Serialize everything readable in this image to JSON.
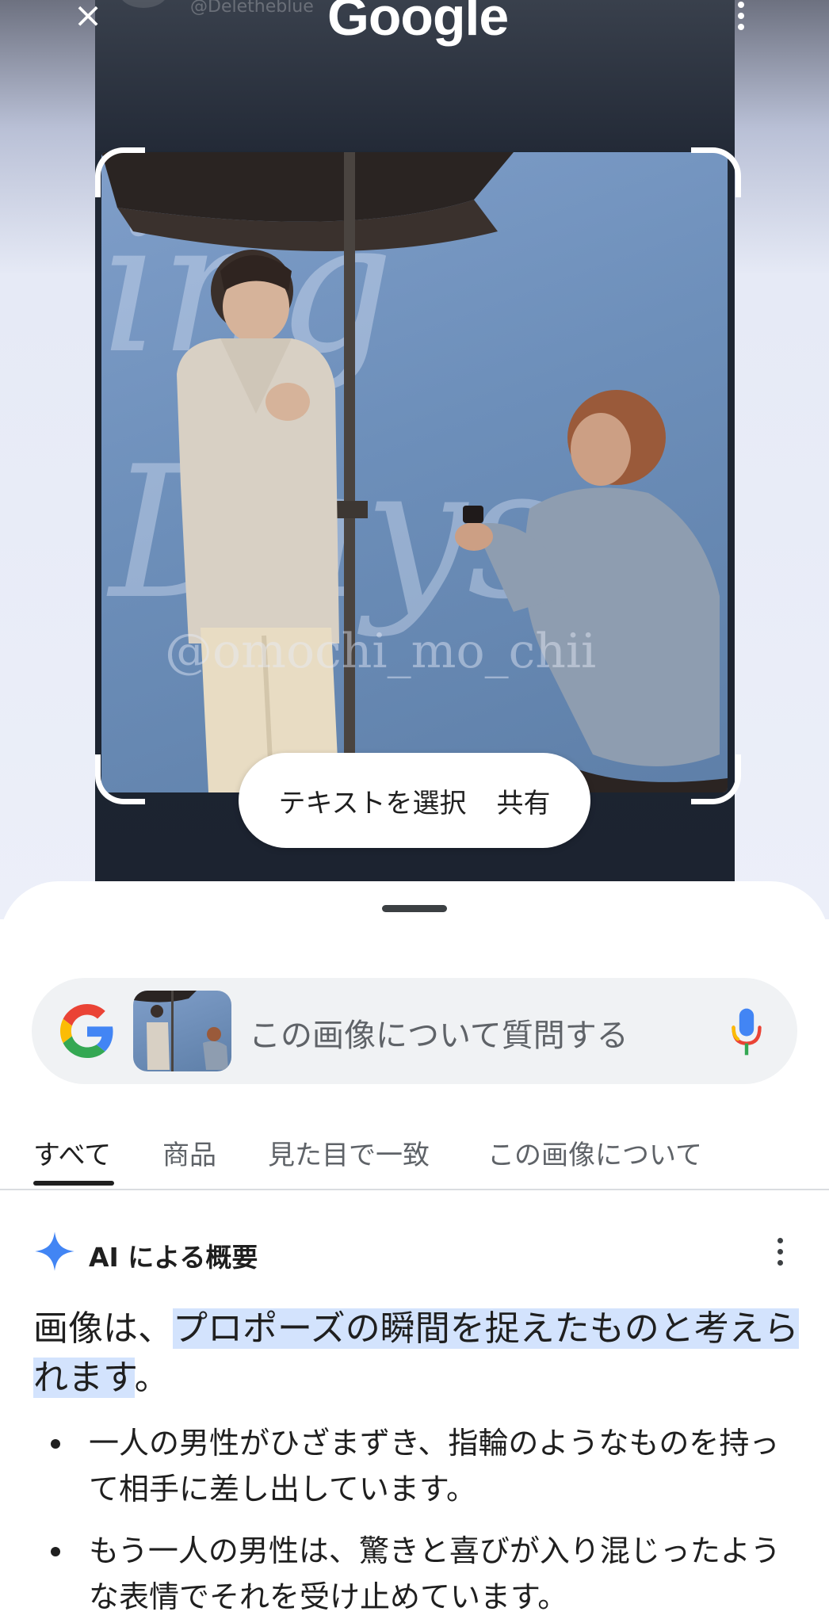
{
  "top_bar": {
    "close_label": "×",
    "logo_text": "Google",
    "menu_icon": "more-vert-icon"
  },
  "screenshot": {
    "ghost_handle": "@Deletheblue",
    "watermark": "@omochi_mo_chii"
  },
  "actions": {
    "select_text": "テキストを選択",
    "share": "共有"
  },
  "search": {
    "placeholder": "この画像について質問する",
    "left_icon": "google-g-icon",
    "right_icon": "mic-icon"
  },
  "tabs": [
    {
      "label": "すべて",
      "active": true
    },
    {
      "label": "商品",
      "active": false
    },
    {
      "label": "見た目で一致",
      "active": false
    },
    {
      "label": "この画像について",
      "active": false
    }
  ],
  "ai_overview": {
    "title": "AI による概要",
    "icon": "sparkle-icon",
    "summary_prefix": "画像は、",
    "summary_highlight": "プロポーズの瞬間を捉えたものと考えられます",
    "summary_suffix": "。",
    "bullets": [
      "一人の男性がひざまずき、指輪のようなものを持って相手に差し出しています。",
      "もう一人の男性は、驚きと喜びが入り混じったような表情でそれを受け止めています。"
    ]
  },
  "colors": {
    "highlight": "#d3e3fd",
    "google_blue": "#4285F4",
    "google_red": "#EA4335",
    "google_yellow": "#FBBC05",
    "google_green": "#34A853"
  }
}
